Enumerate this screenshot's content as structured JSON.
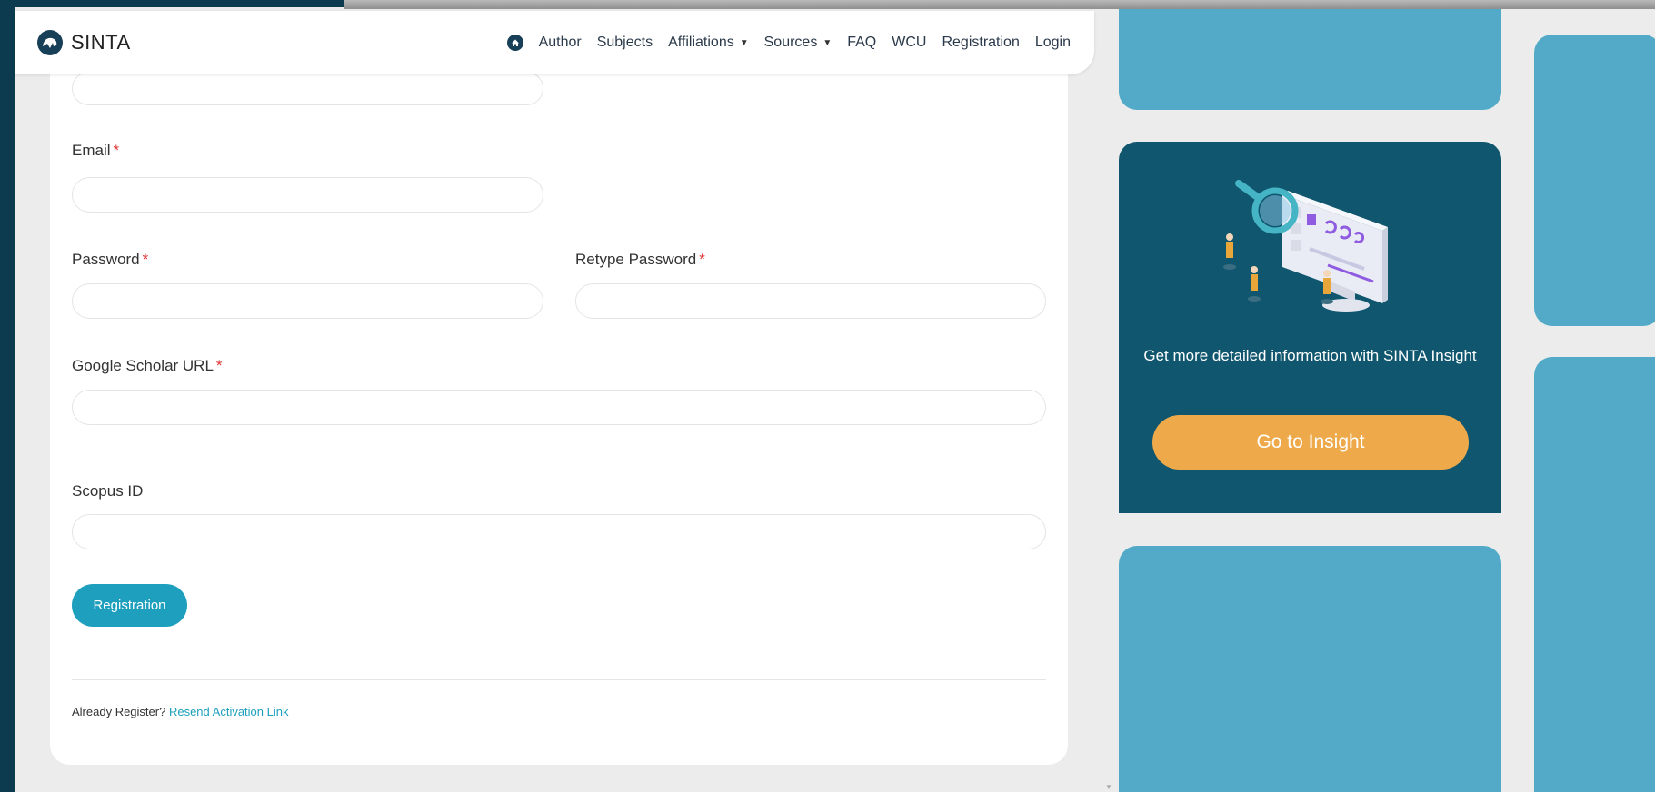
{
  "brand": {
    "name": "SINTA",
    "icon": "sinta-logo-icon"
  },
  "nav": {
    "home_icon": "home-icon",
    "items": [
      {
        "label": "Author"
      },
      {
        "label": "Subjects"
      },
      {
        "label": "Affiliations",
        "dropdown": true
      },
      {
        "label": "Sources",
        "dropdown": true
      },
      {
        "label": "FAQ"
      },
      {
        "label": "WCU"
      },
      {
        "label": "Registration"
      },
      {
        "label": "Login"
      }
    ]
  },
  "form": {
    "required_mark": "*",
    "email_label": "Email",
    "password_label": "Password",
    "retype_password_label": "Retype Password",
    "google_scholar_label": "Google Scholar URL",
    "scopus_label": "Scopus ID",
    "submit_label": "Registration",
    "footer_prefix": "Already Register?",
    "footer_link": "Resend Activation Link"
  },
  "insight": {
    "text": "Get more detailed information with SINTA Insight",
    "button_label": "Go to Insight"
  },
  "colors": {
    "accent": "#1d9fbd",
    "dark_teal": "#0f566e",
    "tile_blue": "#52aac8",
    "insight_button": "#eeaa4a",
    "required": "#dd3333"
  }
}
